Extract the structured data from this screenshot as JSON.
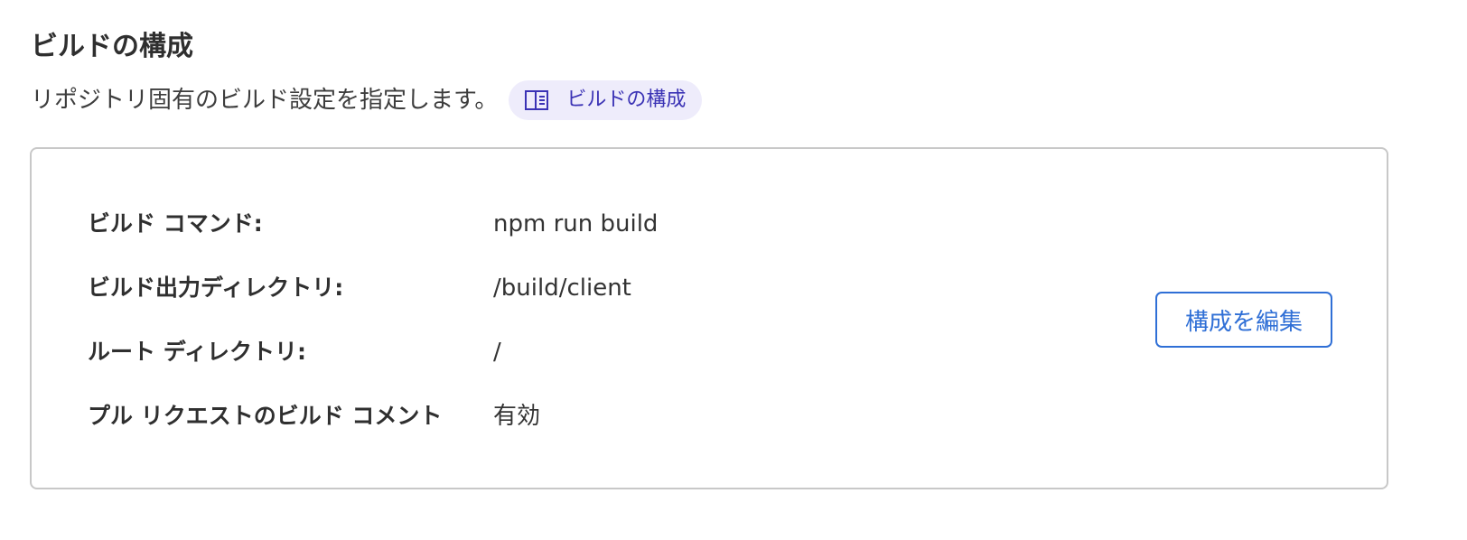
{
  "section": {
    "title": "ビルドの構成",
    "description": "リポジトリ固有のビルド設定を指定します。",
    "doc_link": {
      "icon": "book-open-icon",
      "label": "ビルドの構成"
    }
  },
  "config": {
    "rows": [
      {
        "key": "ビルド コマンド:",
        "value": "npm run build"
      },
      {
        "key": "ビルド出力ディレクトリ:",
        "value": "/build/client"
      },
      {
        "key": "ルート ディレクトリ:",
        "value": "/"
      },
      {
        "key": "プル リクエストのビルド コメント",
        "value": "有効"
      }
    ],
    "edit_label": "構成を編集"
  },
  "colors": {
    "accent": "#2f6fd6",
    "chip_bg": "#eeecfb",
    "chip_text": "#3b33b5",
    "border": "#c8c8c8"
  }
}
